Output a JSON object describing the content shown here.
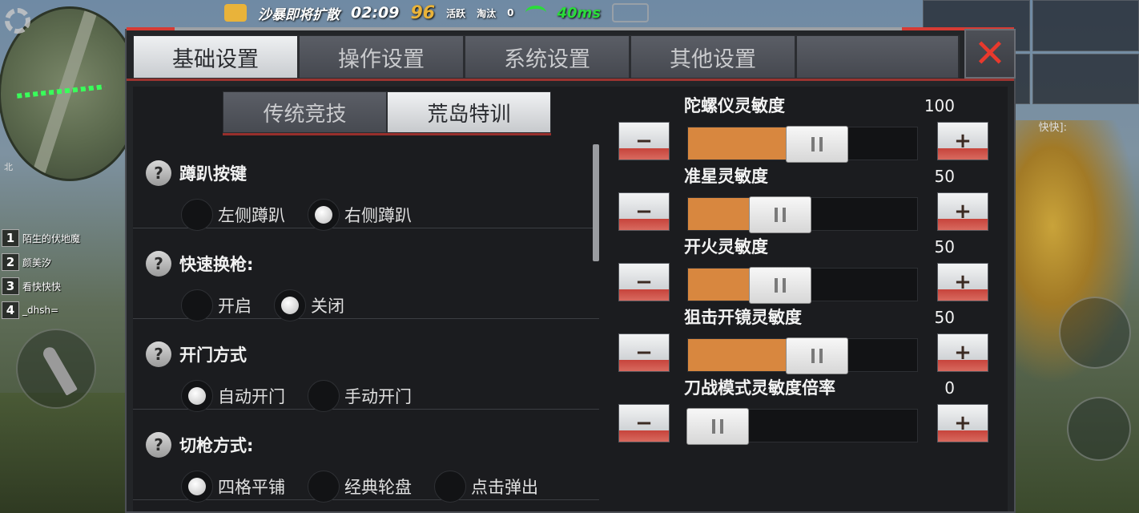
{
  "hud": {
    "zone_notice": "沙暴即将扩散",
    "timer": "02:09",
    "alive_count": "96",
    "alive_label": "活跃",
    "eliminated_label": "淘汰",
    "eliminated_count": "0",
    "ping": "40ms",
    "compass": "北",
    "chat_snippet": "快快]:",
    "team": [
      {
        "num": "1",
        "name": "陌生的伏地魔"
      },
      {
        "num": "2",
        "name": "颜美汐"
      },
      {
        "num": "3",
        "name": "看快快快"
      },
      {
        "num": "4",
        "name": "_dhsh="
      }
    ]
  },
  "panel": {
    "tabs": [
      "基础设置",
      "操作设置",
      "系统设置",
      "其他设置"
    ],
    "active_tab": 0,
    "mode_tabs": [
      "传统竞技",
      "荒岛特训"
    ],
    "active_mode_tab": 1,
    "help_glyph": "?",
    "settings": [
      {
        "title": "蹲趴按键",
        "options": [
          "左侧蹲趴",
          "右侧蹲趴"
        ],
        "selected": 1
      },
      {
        "title": "快速换枪:",
        "options": [
          "开启",
          "关闭"
        ],
        "selected": 1
      },
      {
        "title": "开门方式",
        "options": [
          "自动开门",
          "手动开门"
        ],
        "selected": 0
      },
      {
        "title": "切枪方式:",
        "options": [
          "四格平铺",
          "经典轮盘",
          "点击弹出"
        ],
        "selected": 0
      }
    ],
    "sliders": [
      {
        "title": "陀螺仪灵敏度",
        "value": "100",
        "fill": 0.43
      },
      {
        "title": "准星灵敏度",
        "value": "50",
        "fill": 0.27
      },
      {
        "title": "开火灵敏度",
        "value": "50",
        "fill": 0.27
      },
      {
        "title": "狙击开镜灵敏度",
        "value": "50",
        "fill": 0.43
      },
      {
        "title": "刀战模式灵敏度倍率",
        "value": "0",
        "fill": 0.0
      }
    ],
    "minus_glyph": "−",
    "plus_glyph": "+",
    "close_glyph": "✕"
  },
  "colors": {
    "accent": "#d8873f",
    "close": "#e8392d",
    "tab_underline": "#c43a33"
  }
}
